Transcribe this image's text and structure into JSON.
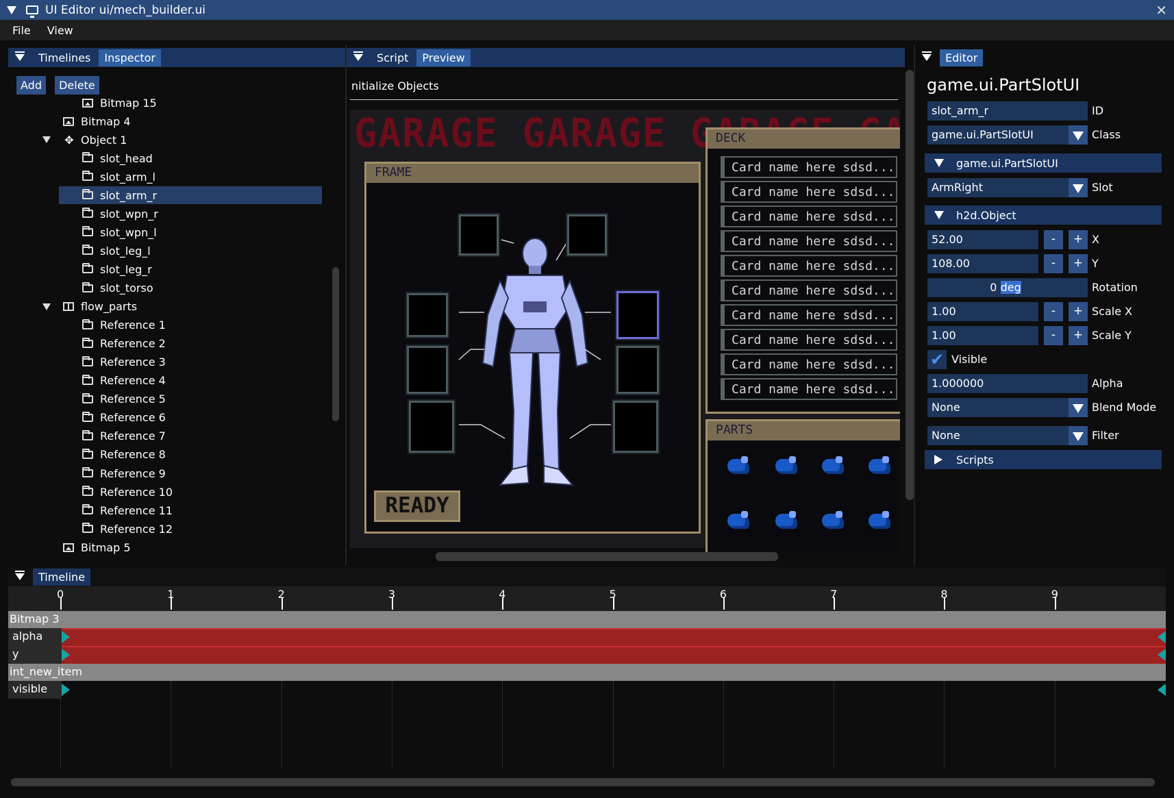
{
  "window": {
    "title": "UI Editor ui/mech_builder.ui"
  },
  "menu": [
    "File",
    "View"
  ],
  "left_panel": {
    "tabs": [
      "Timelines",
      "Inspector"
    ],
    "buttons": {
      "add": "Add",
      "delete": "Delete"
    },
    "tree": [
      {
        "label": "Bitmap 15",
        "icon": "bitmap-icon",
        "level": 2
      },
      {
        "label": "Bitmap 4",
        "icon": "bitmap-icon",
        "level": 1
      },
      {
        "label": "Object 1",
        "icon": "move-icon",
        "level": 1,
        "expanded": true
      },
      {
        "label": "slot_head",
        "icon": "folder-icon",
        "level": 2
      },
      {
        "label": "slot_arm_l",
        "icon": "folder-icon",
        "level": 2
      },
      {
        "label": "slot_arm_r",
        "icon": "folder-icon",
        "level": 2,
        "selected": true
      },
      {
        "label": "slot_wpn_r",
        "icon": "folder-icon",
        "level": 2
      },
      {
        "label": "slot_wpn_l",
        "icon": "folder-icon",
        "level": 2
      },
      {
        "label": "slot_leg_l",
        "icon": "folder-icon",
        "level": 2
      },
      {
        "label": "slot_leg_r",
        "icon": "folder-icon",
        "level": 2
      },
      {
        "label": "slot_torso",
        "icon": "folder-icon",
        "level": 2
      },
      {
        "label": "flow_parts",
        "icon": "flow-icon",
        "level": 1,
        "expanded": true
      },
      {
        "label": "Reference 1",
        "icon": "folder-icon",
        "level": 2
      },
      {
        "label": "Reference 2",
        "icon": "folder-icon",
        "level": 2
      },
      {
        "label": "Reference 3",
        "icon": "folder-icon",
        "level": 2
      },
      {
        "label": "Reference 4",
        "icon": "folder-icon",
        "level": 2
      },
      {
        "label": "Reference 5",
        "icon": "folder-icon",
        "level": 2
      },
      {
        "label": "Reference 6",
        "icon": "folder-icon",
        "level": 2
      },
      {
        "label": "Reference 7",
        "icon": "folder-icon",
        "level": 2
      },
      {
        "label": "Reference 8",
        "icon": "folder-icon",
        "level": 2
      },
      {
        "label": "Reference 9",
        "icon": "folder-icon",
        "level": 2
      },
      {
        "label": "Reference 10",
        "icon": "folder-icon",
        "level": 2
      },
      {
        "label": "Reference 11",
        "icon": "folder-icon",
        "level": 2
      },
      {
        "label": "Reference 12",
        "icon": "folder-icon",
        "level": 2
      },
      {
        "label": "Bitmap 5",
        "icon": "bitmap-icon",
        "level": 1
      }
    ]
  },
  "middle_panel": {
    "tabs": [
      "Script",
      "Preview"
    ],
    "breadcrumb": "nitialize Objects",
    "preview": {
      "banner": "GARAGE GARAGE GARAGE GARAGE",
      "frame_title": "FRAME",
      "ready_label": "READY",
      "deck_title": "DECK",
      "deck_cards": [
        "Card name here sdsd...",
        "Card name here sdsd...",
        "Card name here sdsd...",
        "Card name here sdsd...",
        "Card name here sdsd...",
        "Card name here sdsd...",
        "Card name here sdsd...",
        "Card name here sdsd...",
        "Card name here sdsd...",
        "Card name here sdsd..."
      ],
      "parts_title": "PARTS"
    }
  },
  "right_panel": {
    "tab": "Editor",
    "object_name": "game.ui.PartSlotUI",
    "id_value": "slot_arm_r",
    "id_label": "ID",
    "class_value": "game.ui.PartSlotUI",
    "class_label": "Class",
    "section_class": "game.ui.PartSlotUI",
    "slot_value": "ArmRight",
    "slot_label": "Slot",
    "section_object": "h2d.Object",
    "x_value": "52.00",
    "x_label": "X",
    "y_value": "108.00",
    "y_label": "Y",
    "rotation_num": "0",
    "rotation_unit": "deg",
    "rotation_label": "Rotation",
    "scalex_value": "1.00",
    "scalex_label": "Scale X",
    "scaley_value": "1.00",
    "scaley_label": "Scale Y",
    "visible_label": "Visible",
    "alpha_value": "1.000000",
    "alpha_label": "Alpha",
    "blend_value": "None",
    "blend_label": "Blend Mode",
    "filter_value": "None",
    "filter_label": "Filter",
    "scripts_label": "Scripts",
    "minus": "-",
    "plus": "+"
  },
  "timeline": {
    "title": "Timeline",
    "ruler": [
      "0",
      "1",
      "2",
      "3",
      "4",
      "5",
      "6",
      "7",
      "8",
      "9"
    ],
    "groups": [
      {
        "name": "Bitmap 3",
        "tracks": [
          "alpha",
          "y"
        ]
      },
      {
        "name": "int_new_item",
        "tracks": [
          "visible"
        ]
      }
    ]
  },
  "colors": {
    "accent": "#294a7a",
    "selected": "#263f66",
    "track_bar": "#9c2121",
    "keyframe": "#19a3a3"
  }
}
